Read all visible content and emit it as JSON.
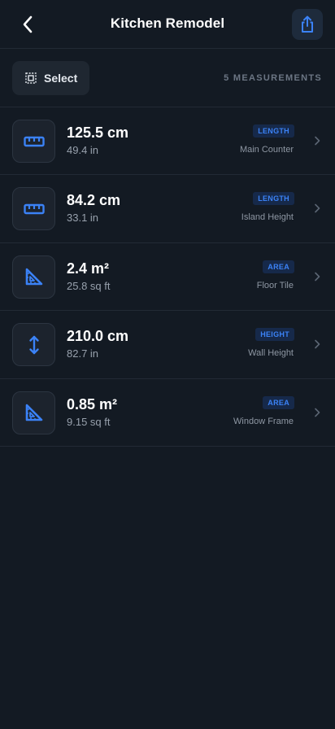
{
  "header": {
    "title": "Kitchen Remodel",
    "back_icon": "chevron-left-icon",
    "share_icon": "share-icon"
  },
  "toolbar": {
    "select_label": "Select",
    "select_icon": "selection-box-icon",
    "count_label": "5 MEASUREMENTS"
  },
  "measurements": [
    {
      "value": "125.5 cm",
      "sub": "49.4 in",
      "badge": "LENGTH",
      "name": "Main Counter",
      "icon": "ruler-icon"
    },
    {
      "value": "84.2 cm",
      "sub": "33.1 in",
      "badge": "LENGTH",
      "name": "Island Height",
      "icon": "ruler-icon"
    },
    {
      "value": "2.4 m²",
      "sub": "25.8 sq ft",
      "badge": "AREA",
      "name": "Floor Tile",
      "icon": "set-square-icon"
    },
    {
      "value": "210.0 cm",
      "sub": "82.7 in",
      "badge": "HEIGHT",
      "name": "Wall Height",
      "icon": "vertical-arrows-icon"
    },
    {
      "value": "0.85 m²",
      "sub": "9.15 sq ft",
      "badge": "AREA",
      "name": "Window Frame",
      "icon": "set-square-icon"
    }
  ],
  "colors": {
    "background": "#131a23",
    "accent": "#3b82f6",
    "badge_bg": "#16294a"
  }
}
